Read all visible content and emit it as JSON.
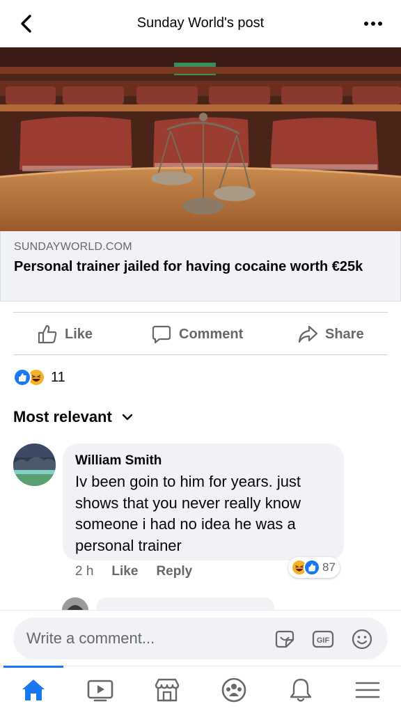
{
  "header": {
    "title": "Sunday World's post",
    "back_icon": "chevron-left-icon",
    "more_icon": "more-horizontal-icon"
  },
  "link_preview": {
    "domain": "SUNDAYWORLD.COM",
    "headline": "Personal trainer jailed for having cocaine worth €25k"
  },
  "actions": {
    "like_label": "Like",
    "comment_label": "Comment",
    "share_label": "Share"
  },
  "reactions": {
    "count": "11",
    "types": [
      "like",
      "haha"
    ]
  },
  "sort": {
    "label": "Most relevant"
  },
  "comment": {
    "author": "William Smith",
    "text": "Iv been goin to him for years. just shows that you never really know someone i had no idea he was a personal trainer",
    "time": "2 h",
    "like_label": "Like",
    "reply_label": "Reply",
    "reaction_count": "87"
  },
  "composer": {
    "placeholder": "Write a comment..."
  },
  "nav": {
    "items": [
      "home-icon",
      "watch-icon",
      "marketplace-icon",
      "groups-icon",
      "notifications-icon",
      "menu-icon"
    ],
    "active": "home-icon"
  },
  "colors": {
    "brand": "#1877f2",
    "secondary_text": "#65676b",
    "bubble": "#f0f2f5"
  }
}
